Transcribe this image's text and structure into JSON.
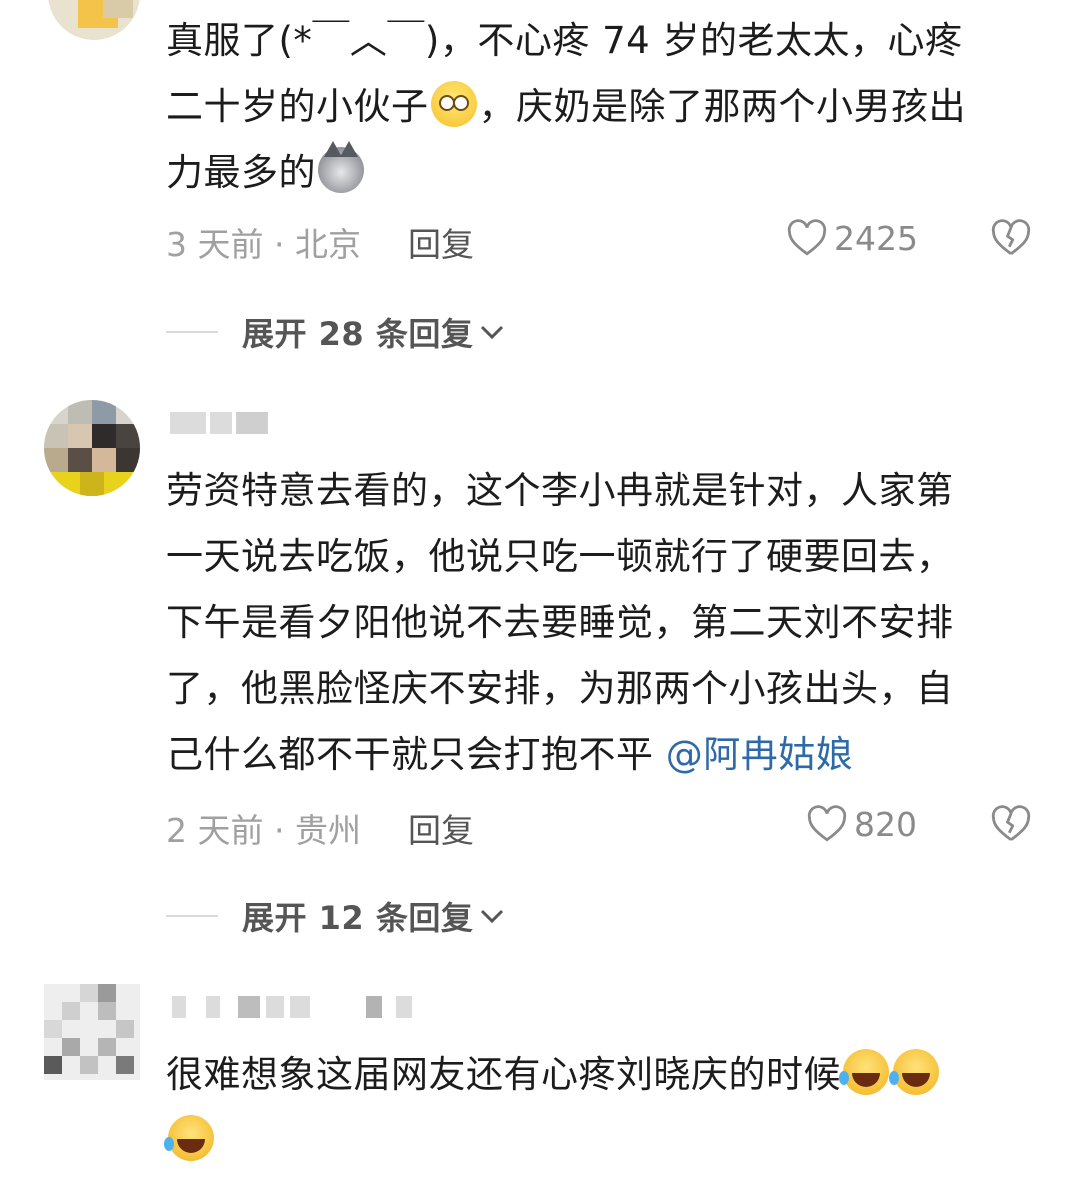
{
  "comments": [
    {
      "text_line1": "真服了(*￣︿￣)，不心疼 74 岁的老太太，心疼",
      "text_line2a": "二十岁的小伙子",
      "text_line2b": "，庆奶是除了那两个小男孩出",
      "text_line3": "力最多的",
      "time_location": "3 天前 · 北京",
      "reply_label": "回复",
      "likes": "2425",
      "expand_label": "展开 28 条回复"
    },
    {
      "text_line1": "劳资特意去看的，这个李小冉就是针对，人家第",
      "text_line2": "一天说去吃饭，他说只吃一顿就行了硬要回去，",
      "text_line3": "下午是看夕阳他说不去要睡觉，第二天刘不安排",
      "text_line4": "了，他黑脸怪庆不安排，为那两个小孩出头，自",
      "text_line5": "己什么都不干就只会打抱不平 ",
      "mention": "@阿冉姑娘",
      "time_location": "2 天前 · 贵州",
      "reply_label": "回复",
      "likes": "820",
      "expand_label": "展开 12 条回复"
    },
    {
      "text_line1": "很难想象这届网友还有心疼刘晓庆的时候",
      "text_line2": ""
    }
  ],
  "icons": {
    "like": "heart-outline-icon",
    "dislike": "broken-heart-icon",
    "expand": "chevron-down-icon",
    "emoji_tear": "tears-of-joy-emoji",
    "emoji_dog": "doge-emoji",
    "emoji_laugh": "rolling-laughing-emoji"
  },
  "colors": {
    "mention": "#2f6aa8",
    "meta": "#a0a0a0"
  }
}
